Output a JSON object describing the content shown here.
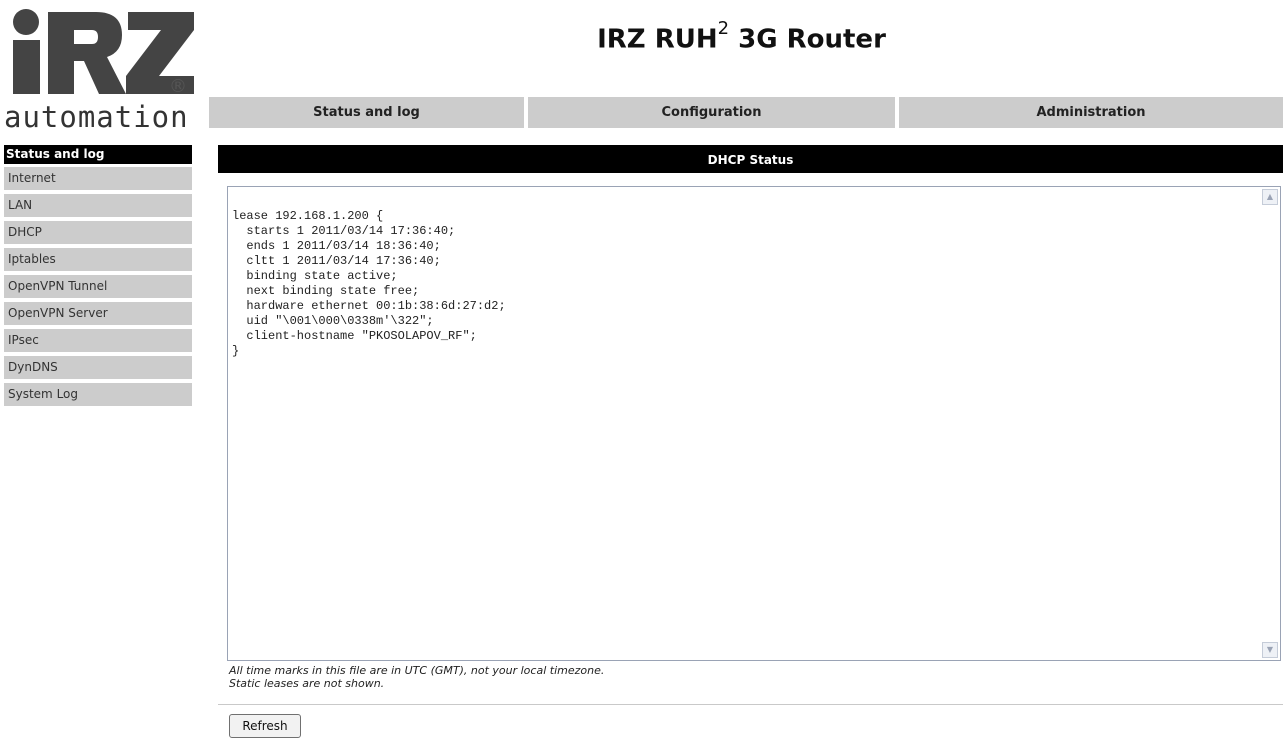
{
  "brand": {
    "logo_letters": "iRZ",
    "logo_registered": "®",
    "logo_word": "automation"
  },
  "header": {
    "title_prefix": "IRZ RUH",
    "title_superscript": "2",
    "title_suffix": "3G Router"
  },
  "topnav": {
    "tabs": [
      {
        "label": "Status and log"
      },
      {
        "label": "Configuration"
      },
      {
        "label": "Administration"
      }
    ]
  },
  "sidebar": {
    "heading": "Status and log",
    "items": [
      {
        "label": "Internet"
      },
      {
        "label": "LAN"
      },
      {
        "label": "DHCP"
      },
      {
        "label": "Iptables"
      },
      {
        "label": "OpenVPN Tunnel"
      },
      {
        "label": "OpenVPN Server"
      },
      {
        "label": "IPsec"
      },
      {
        "label": "DynDNS"
      },
      {
        "label": "System Log"
      }
    ]
  },
  "main": {
    "panel_title": "DHCP Status",
    "log_text": "lease 192.168.1.200 {\n  starts 1 2011/03/14 17:36:40;\n  ends 1 2011/03/14 18:36:40;\n  cltt 1 2011/03/14 17:36:40;\n  binding state active;\n  next binding state free;\n  hardware ethernet 00:1b:38:6d:27:d2;\n  uid \"\\001\\000\\0338m'\\322\";\n  client-hostname \"PKOSOLAPOV_RF\";\n}",
    "note_line1": "All time marks in this file are in UTC (GMT), not your local timezone.",
    "note_line2": "Static leases are not shown.",
    "refresh_label": "Refresh"
  },
  "colors": {
    "nav_background": "#cccccc",
    "header_background": "#000000",
    "logo_text": "#333333"
  }
}
